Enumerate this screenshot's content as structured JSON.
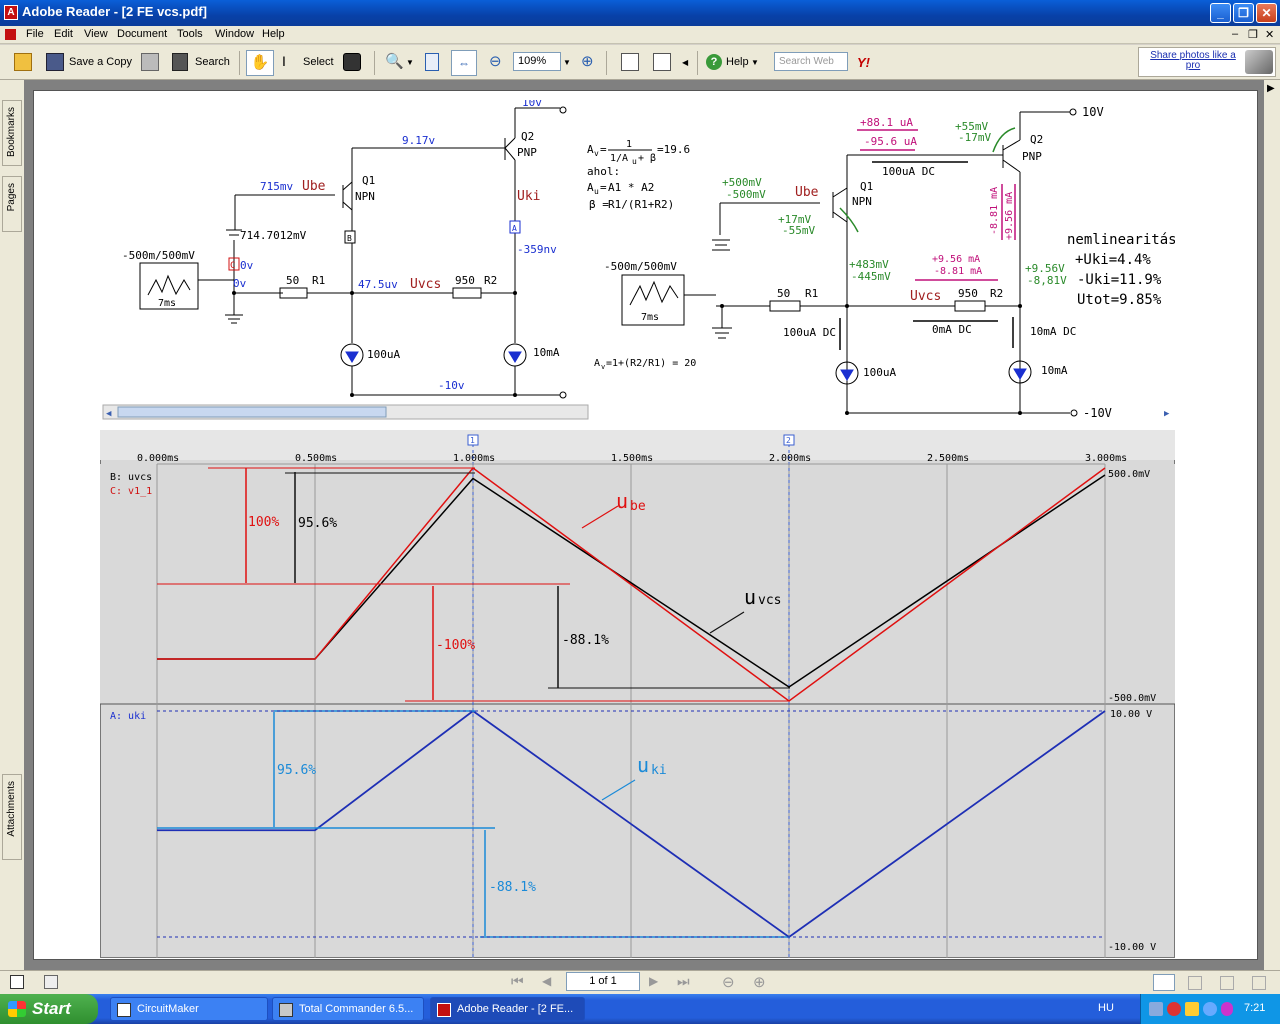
{
  "window": {
    "title": "Adobe Reader - [2 FE vcs.pdf]",
    "icon": "acrobat-icon"
  },
  "menu": [
    "File",
    "Edit",
    "View",
    "Document",
    "Tools",
    "Window",
    "Help"
  ],
  "toolbar": {
    "save_copy": "Save a Copy",
    "search": "Search",
    "select": "Select",
    "zoom": "109%",
    "help": "Help",
    "search_web_placeholder": "Search Web",
    "promo": "Share photos like a pro"
  },
  "navtabs": [
    "Bookmarks",
    "Pages",
    "Attachments"
  ],
  "status": {
    "page": "1 of 1"
  },
  "taskbar": {
    "start": "Start",
    "items": [
      "CircuitMaker",
      "Total Commander 6.5...",
      "Adobe Reader - [2 FE..."
    ],
    "lang": "HU",
    "clock": "7:21"
  },
  "circuit_left": {
    "q2_label": "Q2",
    "q2_type": "PNP",
    "q1_label": "Q1",
    "q1_type": "NPN",
    "v917": "9.17v",
    "v715": "715mv",
    "ube": "Ube",
    "uki": "Uki",
    "v7147": "714.7012mV",
    "src": "-500m/500mV",
    "src_t": "7ms",
    "c0v": "0v",
    "v0v": "0v",
    "r1v": "50",
    "r1": "R1",
    "v475": "47.5uv",
    "uvcs": "Uvcs",
    "r2v": "950",
    "r2": "R2",
    "v359": "-359nv",
    "i100": "100uA",
    "i10": "10mA",
    "vneg10": "-10v",
    "top10": "10v",
    "marker_b": "B",
    "marker_a": "A",
    "marker_c": "C"
  },
  "circuit_right": {
    "av_eq1": "1",
    "av_eq2": "1/A",
    "av_eq3": "=19.6",
    "ahol": "ahol:",
    "au": "A1 * A2",
    "beta": "R1/(R1+R2)",
    "i881": "+88.1 uA",
    "i956": "-95.6 uA",
    "v55": "+55mV",
    "vm17": "-17mV",
    "v10": "10V",
    "q2": "Q2",
    "pnp": "PNP",
    "dc100": "100uA DC",
    "v500p": "+500mV",
    "v500m": "-500mV",
    "ube": "Ube",
    "q1": "Q1",
    "npn": "NPN",
    "ma881": "-8.81 mA",
    "ma956": "+9.56 mA",
    "nl_title": "nemlinearitás:",
    "nl1": "+Uki=4.4%",
    "nl2": "-Uki=11.9%",
    "nl3": "Utot=9.85%",
    "v17p": "+17mV",
    "v55m": "-55mV",
    "src": "-500m/500mV",
    "src_t": "7ms",
    "v483": "+483mV",
    "v445": "-445mV",
    "r956": "+9.56 mA",
    "r881": "-8.81 mA",
    "v956": "+9.56V",
    "v881": "-8,81V",
    "r1v": "50",
    "r1": "R1",
    "uvcs": "Uvcs",
    "r2v": "950",
    "r2": "R2",
    "dc100b": "100uA DC",
    "dc0": "0mA DC",
    "dc10": "10mA DC",
    "i100": "100uA",
    "i10": "10mA",
    "vneg10": "-10V",
    "av2": "A",
    "av2b": "=1+(R2/R1) = 20"
  },
  "chart_data": [
    {
      "type": "line",
      "title": "",
      "xlabel": "",
      "ylabel": "",
      "x_ticks": [
        "0.000ms",
        "0.500ms",
        "1.000ms",
        "1.500ms",
        "2.000ms",
        "2.500ms",
        "3.000ms"
      ],
      "y_labels": [
        "500.0mV",
        "-500.0mV"
      ],
      "legend": [
        "B: uvcs",
        "C: v1_1"
      ],
      "series": [
        {
          "name": "B: uvcs",
          "color": "#000000",
          "x": [
            0,
            0.5,
            1.0,
            2.0,
            3.0
          ],
          "y": [
            -0.32,
            -0.32,
            0.455,
            -0.44,
            0.47
          ]
        },
        {
          "name": "C: v1_1",
          "color": "#e01010",
          "x": [
            0,
            0.5,
            1.0,
            2.0,
            3.0
          ],
          "y": [
            -0.32,
            -0.32,
            0.5,
            -0.5,
            0.5
          ]
        }
      ],
      "annotations": [
        "100%",
        "95.6%",
        "-100%",
        "-88.1%",
        "u",
        "be",
        "u",
        "vcs"
      ]
    },
    {
      "type": "line",
      "x_ticks": [],
      "y_labels": [
        "10.00 V",
        "-10.00 V"
      ],
      "legend": [
        "A: uki"
      ],
      "series": [
        {
          "name": "A: uki",
          "color": "#1e2fb5",
          "x": [
            0,
            0.5,
            1.0,
            2.0,
            3.0
          ],
          "y": [
            -0.55,
            -0.55,
            10,
            -10,
            10
          ]
        }
      ],
      "annotations": [
        "95.6%",
        "-88.1%",
        "u",
        "ki"
      ]
    }
  ]
}
